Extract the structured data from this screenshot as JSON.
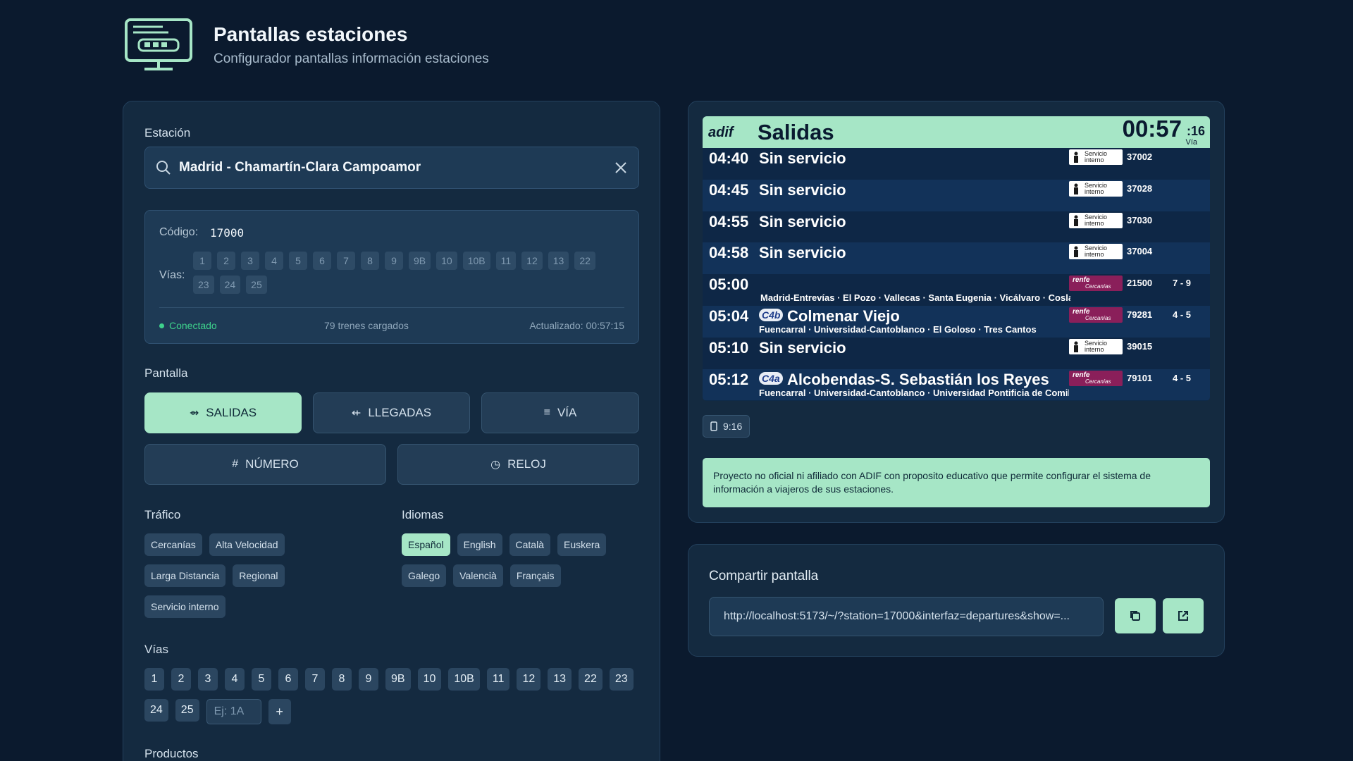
{
  "header": {
    "title": "Pantallas estaciones",
    "subtitle": "Configurador pantallas información estaciones"
  },
  "station": {
    "label": "Estación",
    "value": "Madrid - Chamartín-Clara Campoamor",
    "code_label": "Código:",
    "code": "17000",
    "vias_label": "Vías:",
    "vias": [
      "1",
      "2",
      "3",
      "4",
      "5",
      "6",
      "7",
      "8",
      "9",
      "9B",
      "10",
      "10B",
      "11",
      "12",
      "13",
      "22",
      "23",
      "24",
      "25"
    ],
    "status": "Conectado",
    "trains_loaded": "79 trenes cargados",
    "updated": "Actualizado: 00:57:15"
  },
  "screen": {
    "label": "Pantalla",
    "modes": [
      {
        "label": "SALIDAS",
        "icon": "⇴",
        "active": true
      },
      {
        "label": "LLEGADAS",
        "icon": "⇷",
        "active": false
      },
      {
        "label": "VÍA",
        "icon": "≡",
        "active": false
      },
      {
        "label": "NÚMERO",
        "icon": "#",
        "active": false
      },
      {
        "label": "RELOJ",
        "icon": "◷",
        "active": false
      }
    ]
  },
  "traffic": {
    "label": "Tráfico",
    "options": [
      "Cercanías",
      "Alta Velocidad",
      "Larga Distancia",
      "Regional",
      "Servicio interno"
    ]
  },
  "languages": {
    "label": "Idiomas",
    "options": [
      "Español",
      "English",
      "Català",
      "Euskera",
      "Galego",
      "Valencià",
      "Français"
    ],
    "selected": "Español"
  },
  "vias_filter": {
    "label": "Vías",
    "items": [
      "1",
      "2",
      "3",
      "4",
      "5",
      "6",
      "7",
      "8",
      "9",
      "9B",
      "10",
      "10B",
      "11",
      "12",
      "13",
      "22",
      "23",
      "24",
      "25"
    ],
    "input_placeholder": "Ej: 1A",
    "add_label": "+"
  },
  "products": {
    "label": "Productos"
  },
  "board": {
    "logo": "adif",
    "title": "Salidas",
    "clock": "00:57",
    "seconds": ":16",
    "via_label": "Vía",
    "rows": [
      {
        "time": "04:40",
        "dest": "Sin servicio",
        "line": "",
        "stops": "",
        "operator": "interno",
        "number": "37002",
        "track": ""
      },
      {
        "time": "04:45",
        "dest": "Sin servicio",
        "line": "",
        "stops": "",
        "operator": "interno",
        "number": "37028",
        "track": ""
      },
      {
        "time": "04:55",
        "dest": "Sin servicio",
        "line": "",
        "stops": "",
        "operator": "interno",
        "number": "37030",
        "track": ""
      },
      {
        "time": "04:58",
        "dest": "Sin servicio",
        "line": "",
        "stops": "",
        "operator": "interno",
        "number": "37004",
        "track": ""
      },
      {
        "time": "05:00",
        "dest": "",
        "line": "",
        "stops": "Madrid-Entrevías · El Pozo · Vallecas · Santa Eugenia · Vicálvaro · Coslada",
        "operator": "renfe",
        "number": "21500",
        "track": "7 - 9"
      },
      {
        "time": "05:04",
        "dest": "Colmenar Viejo",
        "line": "C4b",
        "stops": "Fuencarral · Universidad-Cantoblanco · El Goloso · Tres Cantos",
        "operator": "renfe",
        "number": "79281",
        "track": "4 - 5"
      },
      {
        "time": "05:10",
        "dest": "Sin servicio",
        "line": "",
        "stops": "",
        "operator": "interno",
        "number": "39015",
        "track": ""
      },
      {
        "time": "05:12",
        "dest": "Alcobendas-S. Sebastián los Reyes",
        "line": "C4a",
        "stops": "Fuencarral · Universidad-Cantoblanco · Universidad Pontificia de Comillas",
        "operator": "renfe",
        "number": "79101",
        "track": "4 - 5"
      }
    ],
    "badge_interno_line1": "Servicio",
    "badge_interno_line2": "interno",
    "badge_renfe_line1": "renfe",
    "badge_renfe_line2": "Cercanías"
  },
  "aspect": {
    "label": "9:16"
  },
  "notice": "Proyecto no oficial ni afiliado con ADIF con proposito educativo que permite configurar el sistema de información a viajeros de sus estaciones.",
  "share": {
    "title": "Compartir pantalla",
    "url": "http://localhost:5173/~/?station=17000&interfaz=departures&show=..."
  },
  "colors": {
    "background": "#0b1a2e",
    "panel": "#142a40",
    "accent": "#a6e6c6",
    "status_ok": "#3ed18c",
    "renfe": "#8a1f5a"
  }
}
